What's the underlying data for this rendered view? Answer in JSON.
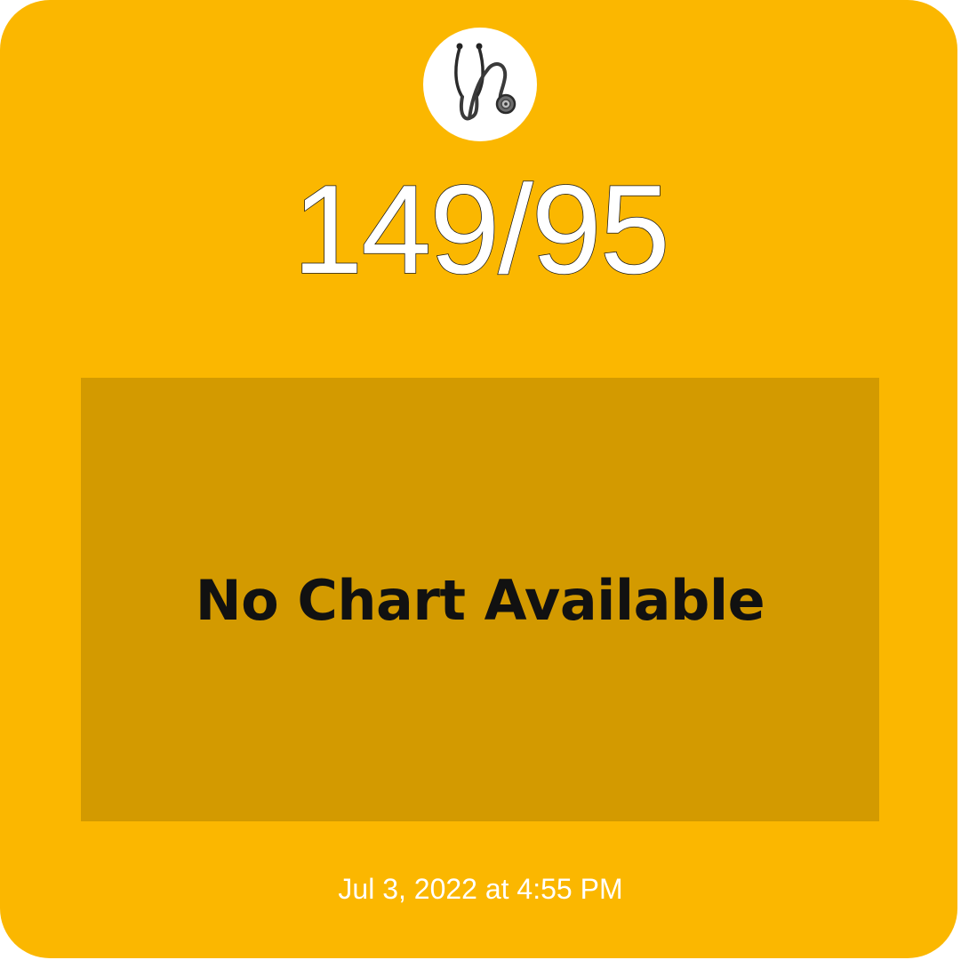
{
  "reading": {
    "value": "149/95"
  },
  "chart": {
    "message": "No Chart Available"
  },
  "timestamp": "Jul 3, 2022 at 4:55 PM",
  "icons": {
    "logo": "stethoscope-icon"
  },
  "colors": {
    "card_background": "#FBB700",
    "chart_placeholder": "#D39A00",
    "reading_text": "#FFFFFF",
    "message_text": "#111111"
  }
}
